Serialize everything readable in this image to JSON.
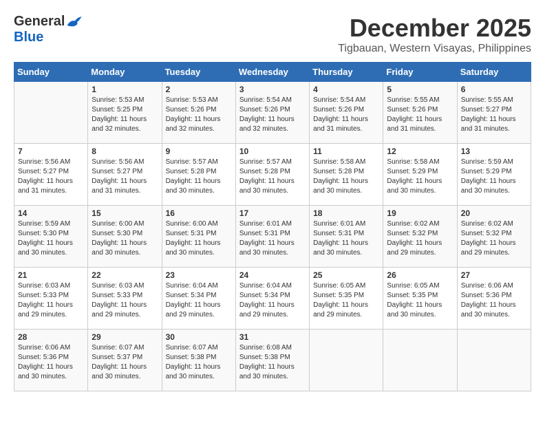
{
  "header": {
    "logo_general": "General",
    "logo_blue": "Blue",
    "month": "December 2025",
    "location": "Tigbauan, Western Visayas, Philippines"
  },
  "days_of_week": [
    "Sunday",
    "Monday",
    "Tuesday",
    "Wednesday",
    "Thursday",
    "Friday",
    "Saturday"
  ],
  "weeks": [
    [
      {
        "day": "",
        "info": ""
      },
      {
        "day": "1",
        "info": "Sunrise: 5:53 AM\nSunset: 5:25 PM\nDaylight: 11 hours\nand 32 minutes."
      },
      {
        "day": "2",
        "info": "Sunrise: 5:53 AM\nSunset: 5:26 PM\nDaylight: 11 hours\nand 32 minutes."
      },
      {
        "day": "3",
        "info": "Sunrise: 5:54 AM\nSunset: 5:26 PM\nDaylight: 11 hours\nand 32 minutes."
      },
      {
        "day": "4",
        "info": "Sunrise: 5:54 AM\nSunset: 5:26 PM\nDaylight: 11 hours\nand 31 minutes."
      },
      {
        "day": "5",
        "info": "Sunrise: 5:55 AM\nSunset: 5:26 PM\nDaylight: 11 hours\nand 31 minutes."
      },
      {
        "day": "6",
        "info": "Sunrise: 5:55 AM\nSunset: 5:27 PM\nDaylight: 11 hours\nand 31 minutes."
      }
    ],
    [
      {
        "day": "7",
        "info": "Sunrise: 5:56 AM\nSunset: 5:27 PM\nDaylight: 11 hours\nand 31 minutes."
      },
      {
        "day": "8",
        "info": "Sunrise: 5:56 AM\nSunset: 5:27 PM\nDaylight: 11 hours\nand 31 minutes."
      },
      {
        "day": "9",
        "info": "Sunrise: 5:57 AM\nSunset: 5:28 PM\nDaylight: 11 hours\nand 30 minutes."
      },
      {
        "day": "10",
        "info": "Sunrise: 5:57 AM\nSunset: 5:28 PM\nDaylight: 11 hours\nand 30 minutes."
      },
      {
        "day": "11",
        "info": "Sunrise: 5:58 AM\nSunset: 5:28 PM\nDaylight: 11 hours\nand 30 minutes."
      },
      {
        "day": "12",
        "info": "Sunrise: 5:58 AM\nSunset: 5:29 PM\nDaylight: 11 hours\nand 30 minutes."
      },
      {
        "day": "13",
        "info": "Sunrise: 5:59 AM\nSunset: 5:29 PM\nDaylight: 11 hours\nand 30 minutes."
      }
    ],
    [
      {
        "day": "14",
        "info": "Sunrise: 5:59 AM\nSunset: 5:30 PM\nDaylight: 11 hours\nand 30 minutes."
      },
      {
        "day": "15",
        "info": "Sunrise: 6:00 AM\nSunset: 5:30 PM\nDaylight: 11 hours\nand 30 minutes."
      },
      {
        "day": "16",
        "info": "Sunrise: 6:00 AM\nSunset: 5:31 PM\nDaylight: 11 hours\nand 30 minutes."
      },
      {
        "day": "17",
        "info": "Sunrise: 6:01 AM\nSunset: 5:31 PM\nDaylight: 11 hours\nand 30 minutes."
      },
      {
        "day": "18",
        "info": "Sunrise: 6:01 AM\nSunset: 5:31 PM\nDaylight: 11 hours\nand 30 minutes."
      },
      {
        "day": "19",
        "info": "Sunrise: 6:02 AM\nSunset: 5:32 PM\nDaylight: 11 hours\nand 29 minutes."
      },
      {
        "day": "20",
        "info": "Sunrise: 6:02 AM\nSunset: 5:32 PM\nDaylight: 11 hours\nand 29 minutes."
      }
    ],
    [
      {
        "day": "21",
        "info": "Sunrise: 6:03 AM\nSunset: 5:33 PM\nDaylight: 11 hours\nand 29 minutes."
      },
      {
        "day": "22",
        "info": "Sunrise: 6:03 AM\nSunset: 5:33 PM\nDaylight: 11 hours\nand 29 minutes."
      },
      {
        "day": "23",
        "info": "Sunrise: 6:04 AM\nSunset: 5:34 PM\nDaylight: 11 hours\nand 29 minutes."
      },
      {
        "day": "24",
        "info": "Sunrise: 6:04 AM\nSunset: 5:34 PM\nDaylight: 11 hours\nand 29 minutes."
      },
      {
        "day": "25",
        "info": "Sunrise: 6:05 AM\nSunset: 5:35 PM\nDaylight: 11 hours\nand 29 minutes."
      },
      {
        "day": "26",
        "info": "Sunrise: 6:05 AM\nSunset: 5:35 PM\nDaylight: 11 hours\nand 30 minutes."
      },
      {
        "day": "27",
        "info": "Sunrise: 6:06 AM\nSunset: 5:36 PM\nDaylight: 11 hours\nand 30 minutes."
      }
    ],
    [
      {
        "day": "28",
        "info": "Sunrise: 6:06 AM\nSunset: 5:36 PM\nDaylight: 11 hours\nand 30 minutes."
      },
      {
        "day": "29",
        "info": "Sunrise: 6:07 AM\nSunset: 5:37 PM\nDaylight: 11 hours\nand 30 minutes."
      },
      {
        "day": "30",
        "info": "Sunrise: 6:07 AM\nSunset: 5:38 PM\nDaylight: 11 hours\nand 30 minutes."
      },
      {
        "day": "31",
        "info": "Sunrise: 6:08 AM\nSunset: 5:38 PM\nDaylight: 11 hours\nand 30 minutes."
      },
      {
        "day": "",
        "info": ""
      },
      {
        "day": "",
        "info": ""
      },
      {
        "day": "",
        "info": ""
      }
    ]
  ]
}
